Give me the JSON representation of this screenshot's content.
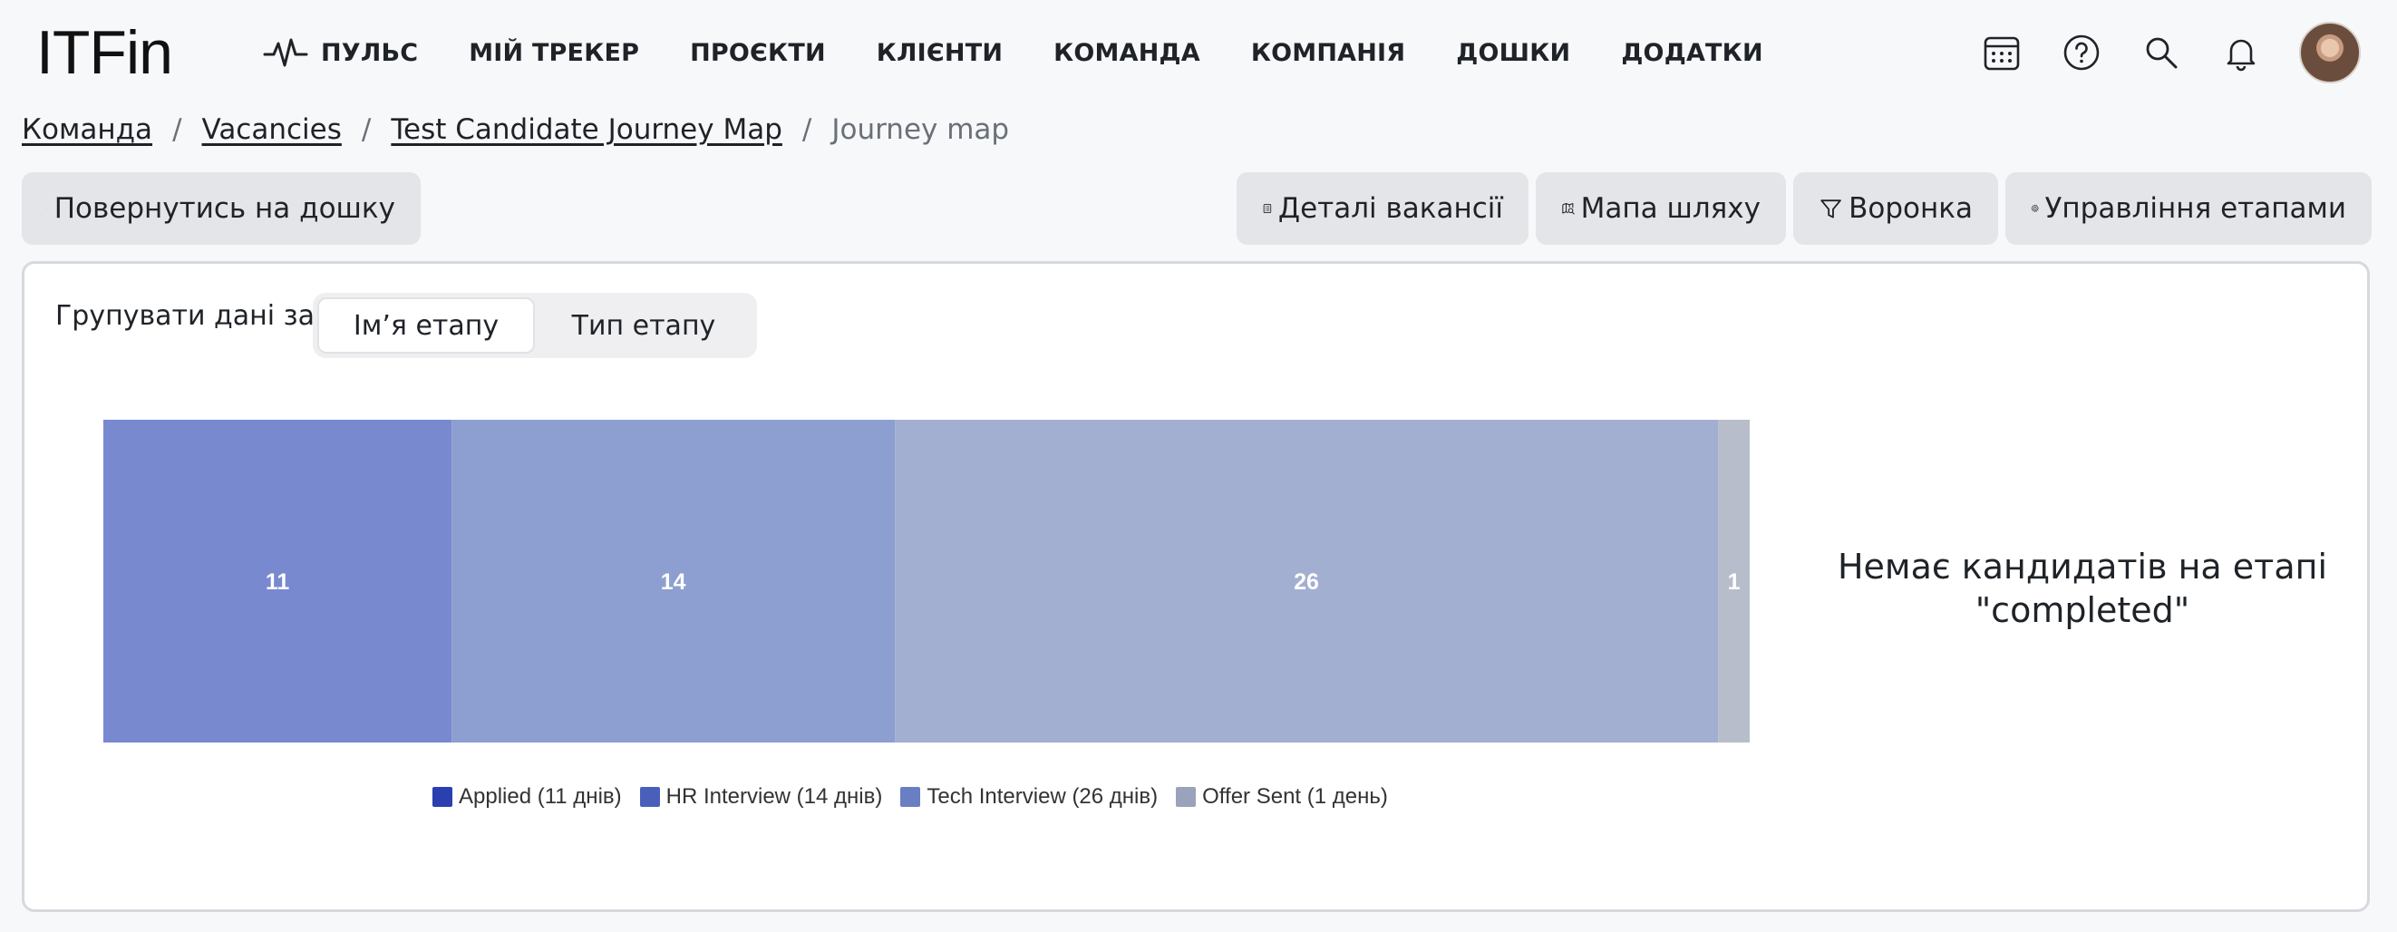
{
  "app": {
    "logo": "ITFin"
  },
  "nav": {
    "items": [
      {
        "label": "ПУЛЬС",
        "icon": "pulse-icon"
      },
      {
        "label": "МІЙ ТРЕКЕР"
      },
      {
        "label": "ПРОЄКТИ"
      },
      {
        "label": "КЛІЄНТИ"
      },
      {
        "label": "КОМАНДА"
      },
      {
        "label": "КОМПАНІЯ"
      },
      {
        "label": "ДОШКИ"
      },
      {
        "label": "ДОДАТКИ"
      }
    ]
  },
  "top_icons": [
    "calendar-icon",
    "help-icon",
    "search-icon",
    "bell-icon",
    "avatar"
  ],
  "breadcrumb": {
    "items": [
      "Команда",
      "Vacancies",
      "Test Candidate Journey Map"
    ],
    "current": "Journey map",
    "separator": "/"
  },
  "toolbar": {
    "back": "Повернутись на дошку",
    "details": "Деталі вакансії",
    "map": "Мапа шляху",
    "funnel": "Воронка",
    "stages": "Управління етапами"
  },
  "panel": {
    "group_label": "Групувати дані за:",
    "group_options": [
      "Ім’я етапу",
      "Тип етапу"
    ],
    "group_selected": "Ім’я етапу",
    "no_candidates": "Немає кандидатів на етапі \"completed\""
  },
  "chart_data": {
    "type": "bar",
    "orientation": "horizontal-stacked",
    "categories": [
      "Applied",
      "HR Interview",
      "Tech Interview",
      "Offer Sent"
    ],
    "values": [
      11,
      14,
      26,
      1
    ],
    "data_labels": [
      "11",
      "14",
      "26",
      "1"
    ],
    "series": [
      {
        "name": "Applied (11 днів)",
        "value": 11,
        "color": "#2a3fb0",
        "fill": "#7889cf"
      },
      {
        "name": "HR Interview (14 днів)",
        "value": 14,
        "color": "#4a5fbb",
        "fill": "#8d9ed0"
      },
      {
        "name": "Tech Interview (26 днів)",
        "value": 26,
        "color": "#6a7ec3",
        "fill": "#a3afd1"
      },
      {
        "name": "Offer Sent (1 день)",
        "value": 1,
        "color": "#9aa3bb",
        "fill": "#b8bdcb"
      }
    ],
    "legend_position": "bottom",
    "grid": false
  }
}
